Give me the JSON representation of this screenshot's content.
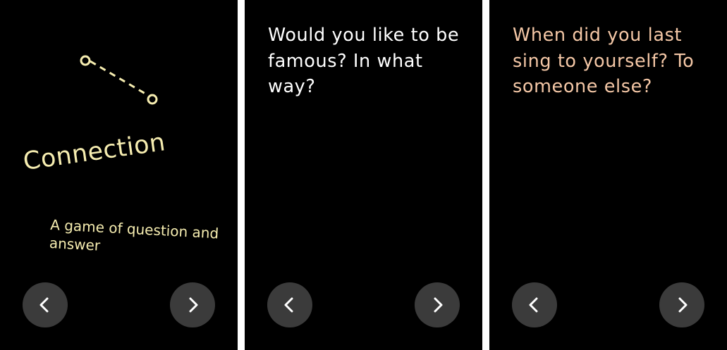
{
  "colors": {
    "background": "#000000",
    "separator": "#ffffff",
    "title_accent": "#f6edb0",
    "question_primary": "#ffffff",
    "question_secondary": "#f4c7a6",
    "nav_button": "#3b3b3b"
  },
  "cards": [
    {
      "title": "Connection",
      "subtitle": "A game of question and answer",
      "icon": "dashed-connection-icon",
      "prev_icon": "chevron-left-icon",
      "next_icon": "chevron-right-icon"
    },
    {
      "question": "Would you like to be famous? In what way?",
      "prev_icon": "chevron-left-icon",
      "next_icon": "chevron-right-icon"
    },
    {
      "question": "When did you last sing to yourself? To someone else?",
      "prev_icon": "chevron-left-icon",
      "next_icon": "chevron-right-icon"
    }
  ]
}
